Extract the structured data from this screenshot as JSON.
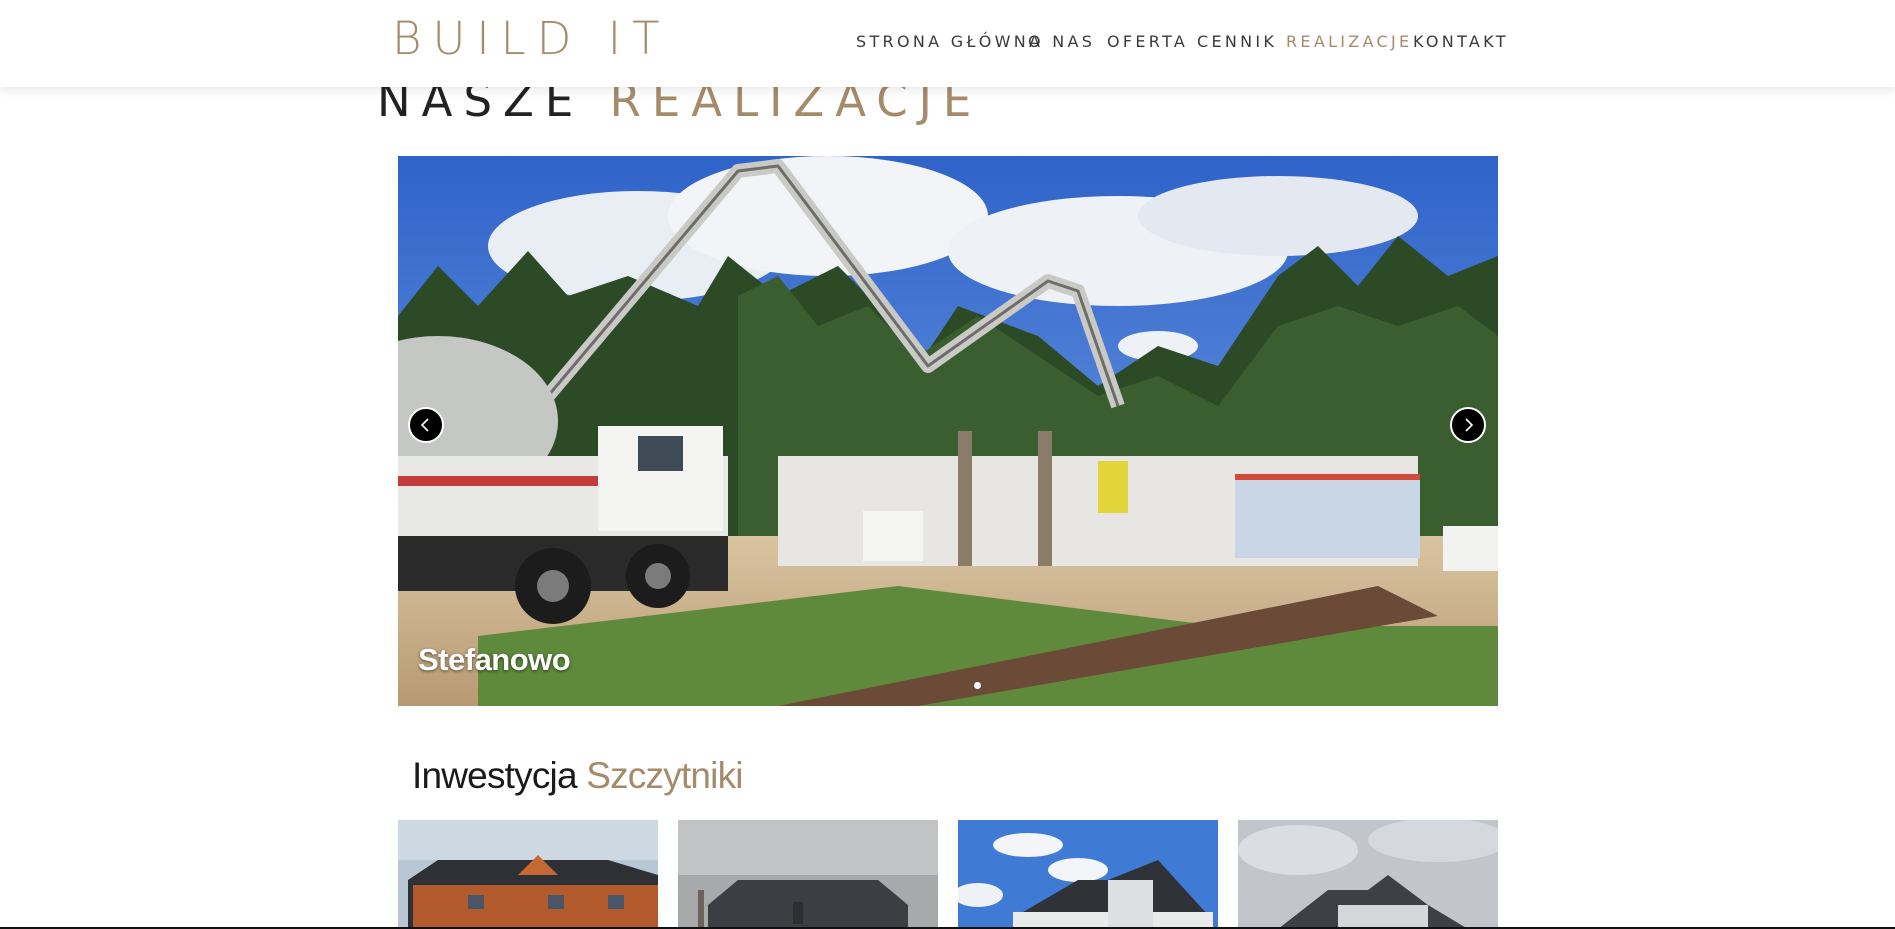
{
  "header": {
    "logo": "BUILD IT",
    "nav": [
      {
        "label": "STRONA GŁÓWNA",
        "active": false
      },
      {
        "label": "O NAS",
        "active": false
      },
      {
        "label": "OFERTA",
        "active": false
      },
      {
        "label": "CENNIK",
        "active": false
      },
      {
        "label": "REALIZACJE",
        "active": true
      },
      {
        "label": "KONTAKT",
        "active": false
      }
    ]
  },
  "page_title": {
    "part1": "NASZE",
    "part2": "REALIZACJE"
  },
  "slider": {
    "caption": "Stefanowo",
    "prev_icon": "chevron-left-icon",
    "next_icon": "chevron-right-icon",
    "image": "construction site with concrete pump truck"
  },
  "investment": {
    "title_part1": "Inwestycja",
    "title_part2": "Szczytniki",
    "thumbnails": [
      {
        "image": "brick townhouses with dark roof"
      },
      {
        "image": "grey semi-detached houses under overcast sky"
      },
      {
        "image": "white houses with dark roof under blue sky"
      },
      {
        "image": "grey modern house under cloudy sky"
      }
    ]
  },
  "colors": {
    "accent": "#a68b6b",
    "text": "#222222"
  }
}
